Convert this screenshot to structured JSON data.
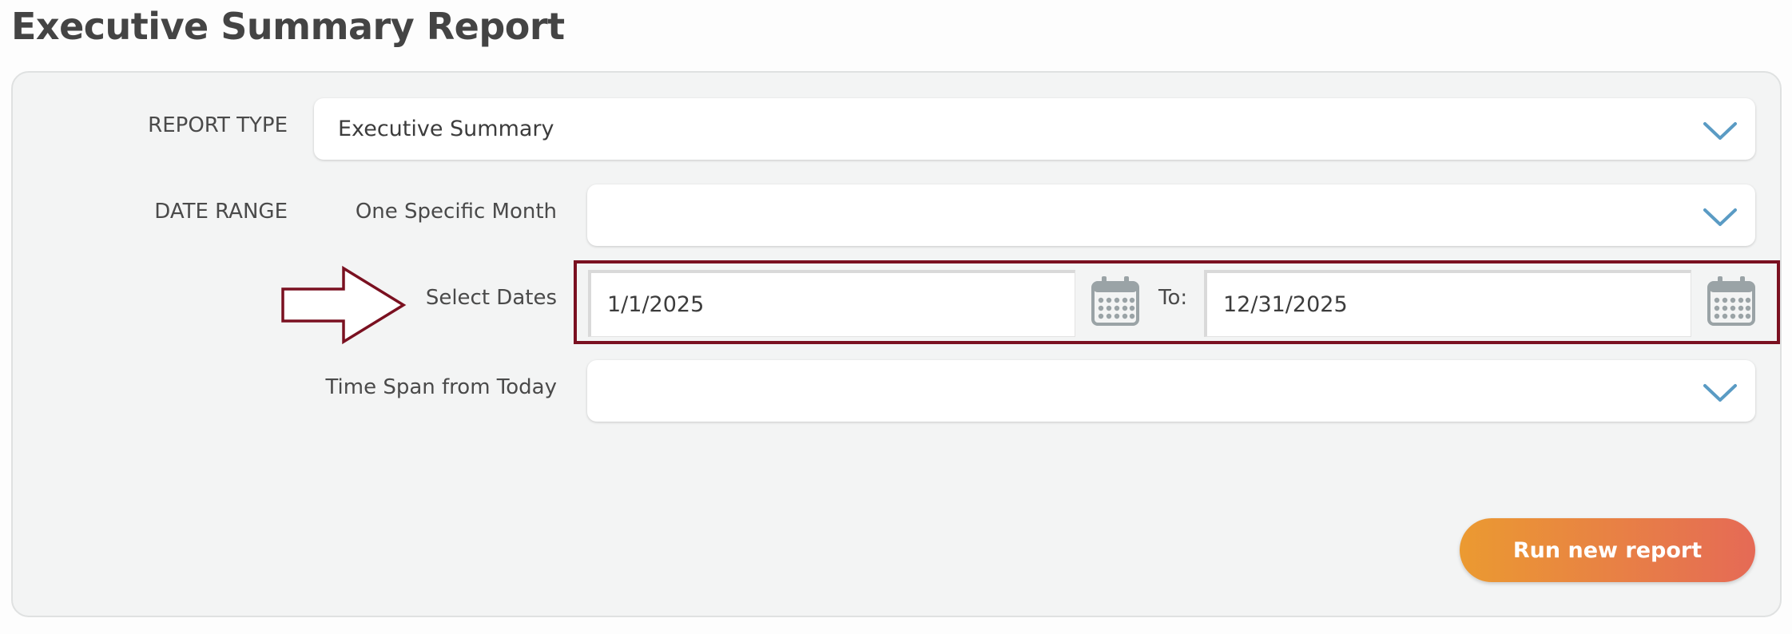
{
  "page": {
    "title": "Executive Summary Report"
  },
  "report_type": {
    "label": "REPORT TYPE",
    "selected": "Executive Summary"
  },
  "date_range": {
    "label": "DATE RANGE",
    "one_specific_month": {
      "label": "One Specific Month",
      "selected": ""
    },
    "select_dates": {
      "label": "Select Dates",
      "from_value": "1/1/2025",
      "to_label": "To:",
      "to_value": "12/31/2025"
    },
    "time_span": {
      "label": "Time Span from Today",
      "selected": ""
    }
  },
  "actions": {
    "run_label": "Run new report"
  },
  "colors": {
    "accent_gradient_start": "#eb9a31",
    "accent_gradient_end": "#e56a56",
    "highlight": "#7a1020",
    "chevron": "#5a9bc4",
    "calendar_icon": "#9aa3a6"
  },
  "icons": {
    "dropdown": "chevron-down-icon",
    "calendar": "calendar-icon",
    "annotation": "arrow-right-icon"
  }
}
